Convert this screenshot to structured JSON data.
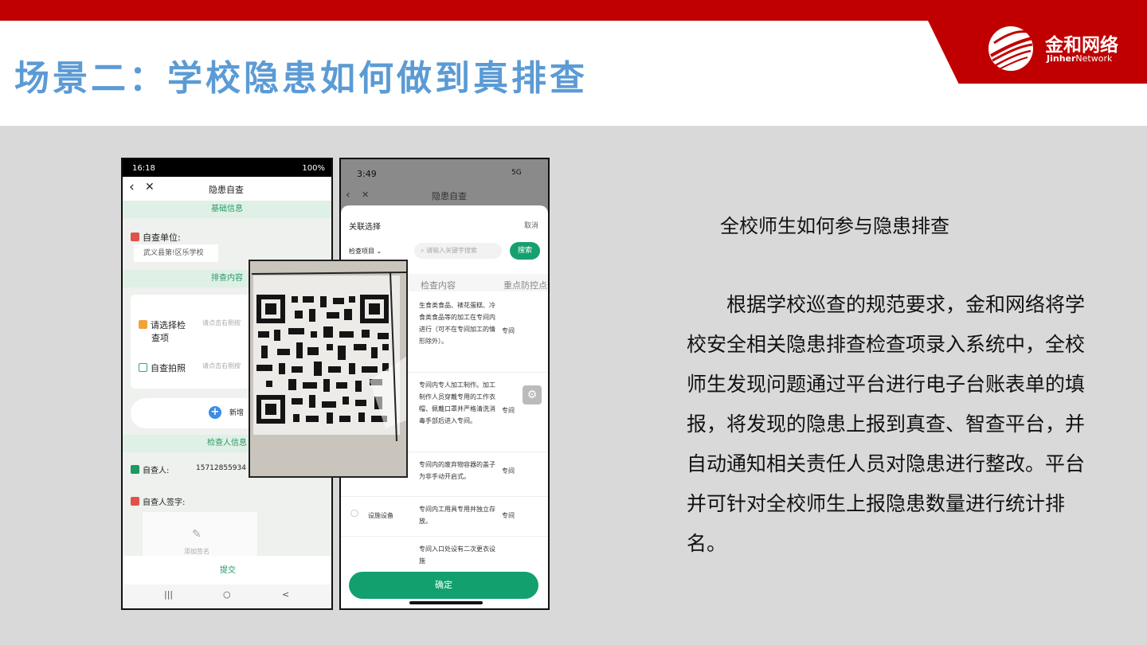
{
  "slide": {
    "title": "场景二：学校隐患如何做到真排查",
    "logo_cn": "金和网络",
    "logo_en_bold": "Jinher",
    "logo_en_rest": "Network",
    "colors": {
      "brand_red": "#c00000",
      "title_blue": "#5b9bd5",
      "accent_green": "#16a070"
    }
  },
  "phone1": {
    "status_time": "16:18",
    "status_right": "100%",
    "nav_title": "隐患自查",
    "section_basic": "基础信息",
    "unit_label": "自查单位:",
    "unit_value": "武义县第!区乐学校",
    "section_content": "排查内容",
    "select_item_label_1": "请选择检",
    "select_item_label_2": "查项",
    "select_placeholder": "请点击右侧按",
    "photo_label": "自查拍照",
    "photo_placeholder": "请点击右侧按",
    "add_label": "新增",
    "section_inspector": "检查人信息",
    "inspector_label": "自查人:",
    "inspector_value": "15712855934",
    "signature_label": "自查人签字:",
    "add_signature": "添加签名",
    "submit": "提交",
    "sysnav": {
      "menu": "|||",
      "home": "○",
      "back": "<"
    }
  },
  "phone2": {
    "status_time": "3:49",
    "status_right": "5G",
    "nav_title": "隐患自查",
    "sheet_title": "关联选择",
    "cancel": "取消",
    "filter": "检查项目",
    "search_placeholder": "请输入关键字搜索",
    "search_button": "搜索",
    "col_content": "检查内容",
    "col_focus": "重点防控点位",
    "rows": [
      {
        "category": "",
        "content": "生食类食品、裱花蛋糕、冷食类食品等的加工在专间内进行（可不在专间加工的情形除外）。",
        "focus": "专间"
      },
      {
        "category": "",
        "content": "专间内专人加工制作。加工制作人员穿戴专用的工作衣帽、佩戴口罩并严格清洗消毒手部后进入专间。",
        "focus": "专间"
      },
      {
        "category": "",
        "content": "专间内的废弃物容器的盖子为非手动开启式。",
        "focus": "专间"
      },
      {
        "category": "设施设备",
        "content": "专间内工用具专用并独立存放。",
        "focus": "专间"
      },
      {
        "category": "",
        "content": "专间入口处设有二次更衣设施",
        "focus": ""
      }
    ],
    "confirm": "确定"
  },
  "text": {
    "heading": "全校师生如何参与隐患排查",
    "body": "根据学校巡查的规范要求，金和网络将学校安全相关隐患排查检查项录入系统中，全校师生发现问题通过平台进行电子台账表单的填报，将发现的隐患上报到真查、智查平台，并自动通知相关责任人员对隐患进行整改。平台并可针对全校师生上报隐患数量进行统计排名。"
  }
}
